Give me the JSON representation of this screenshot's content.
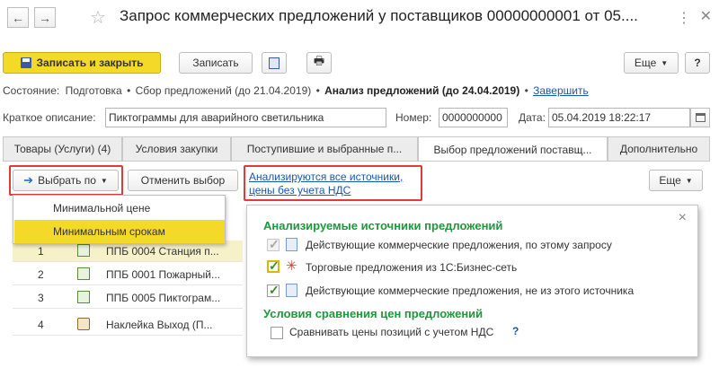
{
  "window": {
    "title": "Запрос коммерческих предложений у поставщиков 00000000001 от 05...."
  },
  "toolbar": {
    "save_close": "Записать и закрыть",
    "save": "Записать",
    "more": "Еще",
    "help": "?"
  },
  "status": {
    "label": "Состояние:",
    "step1": "Подготовка",
    "step2": "Сбор предложений (до 21.04.2019)",
    "step3": "Анализ предложений (до 24.04.2019)",
    "finish": "Завершить",
    "sep": "•"
  },
  "form": {
    "desc_label": "Краткое описание:",
    "desc_value": "Пиктограммы для аварийного светильника",
    "num_label": "Номер:",
    "num_value": "0000000000",
    "date_label": "Дата:",
    "date_value": "05.04.2019 18:22:17"
  },
  "tabs": [
    {
      "label": "Товары (Услуги) (4)"
    },
    {
      "label": "Условия закупки"
    },
    {
      "label": "Поступившие и выбранные п..."
    },
    {
      "label": "Выбор предложений поставщ..."
    },
    {
      "label": "Дополнительно"
    }
  ],
  "inner_toolbar": {
    "select_by": "Выбрать по",
    "cancel_select": "Отменить выбор",
    "link_line1": "Анализируются все источники,",
    "link_line2": "цены без учета НДС",
    "more": "Еще"
  },
  "dropdown": {
    "items": [
      "Минимальной цене",
      "Минимальным срокам"
    ],
    "highlighted": "Минимальным срокам"
  },
  "grid": {
    "rows": [
      {
        "num": "1",
        "text": "ППБ 0004 Станция п..."
      },
      {
        "num": "2",
        "text": "ППБ 0001 Пожарный..."
      },
      {
        "num": "3",
        "text": "ППБ 0005 Пиктограм..."
      },
      {
        "num": "4",
        "text": "Наклейка Выход (П..."
      }
    ]
  },
  "popup": {
    "heading1": "Анализируемые источники предложений",
    "src1": "Действующие коммерческие предложения, по этому запросу",
    "src2": "Торговые предложения из 1С:Бизнес-сеть",
    "src3": "Действующие коммерческие предложения, не из этого источника",
    "heading2": "Условия сравнения цен предложений",
    "vat": "Сравнивать цены позиций с учетом НДС",
    "help": "?",
    "close": "×"
  },
  "colors": {
    "accent_yellow": "#f5d928",
    "highlight_red": "#e03a3a",
    "green_heading": "#1a9a3a",
    "link_blue": "#1a56b0"
  }
}
